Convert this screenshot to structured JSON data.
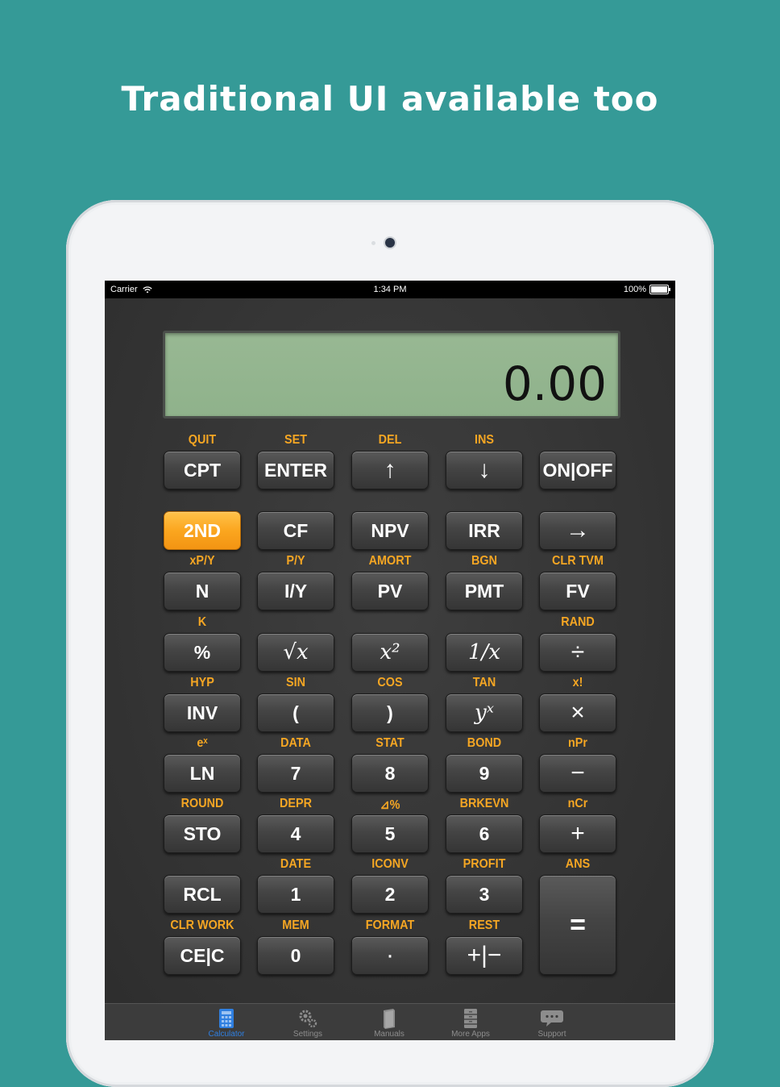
{
  "headline": "Traditional UI available too",
  "status": {
    "carrier": "Carrier",
    "time": "1:34 PM",
    "battery": "100%"
  },
  "display": {
    "value": "0.00"
  },
  "labels": [
    [
      "QUIT",
      "SET",
      "DEL",
      "INS",
      ""
    ],
    [
      "",
      "",
      "",
      "",
      ""
    ],
    [
      "xP/Y",
      "P/Y",
      "AMORT",
      "BGN",
      "CLR TVM"
    ],
    [
      "K",
      "",
      "",
      "",
      "RAND"
    ],
    [
      "HYP",
      "SIN",
      "COS",
      "TAN",
      "x!"
    ],
    [
      "eˣ",
      "DATA",
      "STAT",
      "BOND",
      "nPr"
    ],
    [
      "ROUND",
      "DEPR",
      "⊿%",
      "BRKEVN",
      "nCr"
    ],
    [
      "",
      "DATE",
      "ICONV",
      "PROFIT",
      "ANS"
    ],
    [
      "CLR WORK",
      "MEM",
      "FORMAT",
      "REST",
      ""
    ]
  ],
  "keys": [
    [
      "CPT",
      "ENTER",
      "↑",
      "↓",
      "ON|OFF"
    ],
    [
      "2ND",
      "CF",
      "NPV",
      "IRR",
      "→"
    ],
    [
      "N",
      "I/Y",
      "PV",
      "PMT",
      "FV"
    ],
    [
      "%",
      "√x",
      "x²",
      "1/x",
      "÷"
    ],
    [
      "INV",
      "(",
      ")",
      "yˣ",
      "×"
    ],
    [
      "LN",
      "7",
      "8",
      "9",
      "−"
    ],
    [
      "STO",
      "4",
      "5",
      "6",
      "+"
    ],
    [
      "RCL",
      "1",
      "2",
      "3",
      "="
    ],
    [
      "CE|C",
      "0",
      "·",
      "+|−",
      ""
    ]
  ],
  "tabs": [
    {
      "label": "Calculator",
      "icon": "calculator-icon",
      "active": true
    },
    {
      "label": "Settings",
      "icon": "gear-icon",
      "active": false
    },
    {
      "label": "Manuals",
      "icon": "book-icon",
      "active": false
    },
    {
      "label": "More Apps",
      "icon": "cabinet-icon",
      "active": false
    },
    {
      "label": "Support",
      "icon": "chat-bubble-icon",
      "active": false
    }
  ],
  "colors": {
    "background": "#359a97",
    "accent": "#f5a623",
    "lcd": "#8fb28b",
    "active_tab": "#2f7fe0"
  }
}
